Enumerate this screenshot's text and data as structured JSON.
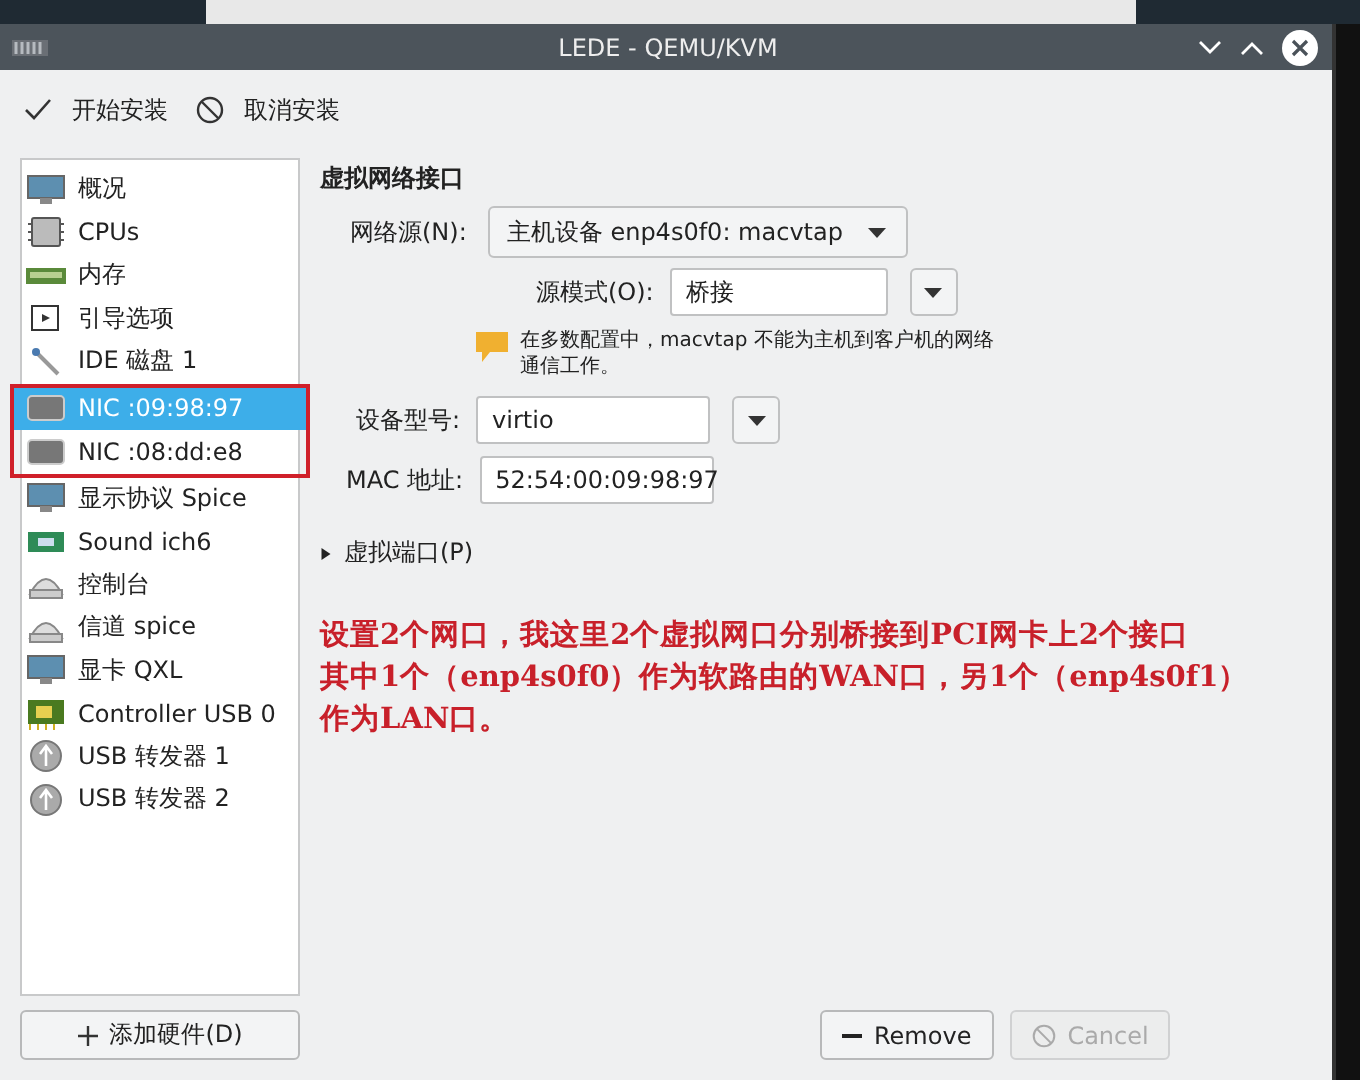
{
  "window": {
    "title": "LEDE - QEMU/KVM"
  },
  "toolbar": [
    {
      "label": "开始安装",
      "kind": "check"
    },
    {
      "label": "取消安装",
      "kind": "cancel"
    }
  ],
  "hardware_list": {
    "items": [
      {
        "label": "概况",
        "kind": "monitor",
        "selected": false,
        "framed": false
      },
      {
        "label": "CPUs",
        "kind": "cpu",
        "selected": false,
        "framed": false
      },
      {
        "label": "内存",
        "kind": "memory",
        "selected": false,
        "framed": false
      },
      {
        "label": "引导选项",
        "kind": "boot",
        "selected": false,
        "framed": false
      },
      {
        "label": "IDE 磁盘 1",
        "kind": "disk",
        "selected": false,
        "framed": false
      },
      {
        "label": "NIC :09:98:97",
        "kind": "nic",
        "selected": true,
        "framed": true
      },
      {
        "label": "NIC :08:dd:e8",
        "kind": "nic",
        "selected": false,
        "framed": true
      },
      {
        "label": "显示协议 Spice",
        "kind": "monitor",
        "selected": false,
        "framed": false
      },
      {
        "label": "Sound ich6",
        "kind": "sound",
        "selected": false,
        "framed": false
      },
      {
        "label": "控制台",
        "kind": "serial",
        "selected": false,
        "framed": false
      },
      {
        "label": "信道 spice",
        "kind": "serial",
        "selected": false,
        "framed": false
      },
      {
        "label": "显卡 QXL",
        "kind": "monitor",
        "selected": false,
        "framed": false
      },
      {
        "label": "Controller USB 0",
        "kind": "controller",
        "selected": false,
        "framed": false
      },
      {
        "label": "USB 转发器 1",
        "kind": "usb",
        "selected": false,
        "framed": false
      },
      {
        "label": "USB 转发器 2",
        "kind": "usb",
        "selected": false,
        "framed": false
      }
    ]
  },
  "details": {
    "section_title": "虚拟网络接口",
    "network_source": {
      "label": "网络源(N):",
      "value": "主机设备 enp4s0f0: macvtap"
    },
    "source_mode": {
      "label": "源模式(O):",
      "value": "桥接"
    },
    "warning": "在多数配置中，macvtap 不能为主机到客户机的网络通信工作。",
    "device_model": {
      "label": "设备型号:",
      "value": "virtio"
    },
    "mac_address": {
      "label": "MAC 地址:",
      "value": "52:54:00:09:98:97"
    },
    "virtual_port": {
      "label": "虚拟端口(P)",
      "expanded": false
    }
  },
  "annotation": [
    "设置2个网口，我这里2个虚拟网口分别桥接到PCI网卡上2个接口",
    "其中1个（enp4s0f0）作为软路由的WAN口，另1个（enp4s0f1）",
    "作为LAN口。"
  ],
  "buttons": {
    "add_hardware": {
      "label": "添加硬件(D)"
    },
    "actions": [
      {
        "label": "Remove",
        "kind": "remove",
        "disabled": false
      },
      {
        "label": "Cancel",
        "kind": "cancel",
        "disabled": true
      }
    ]
  }
}
